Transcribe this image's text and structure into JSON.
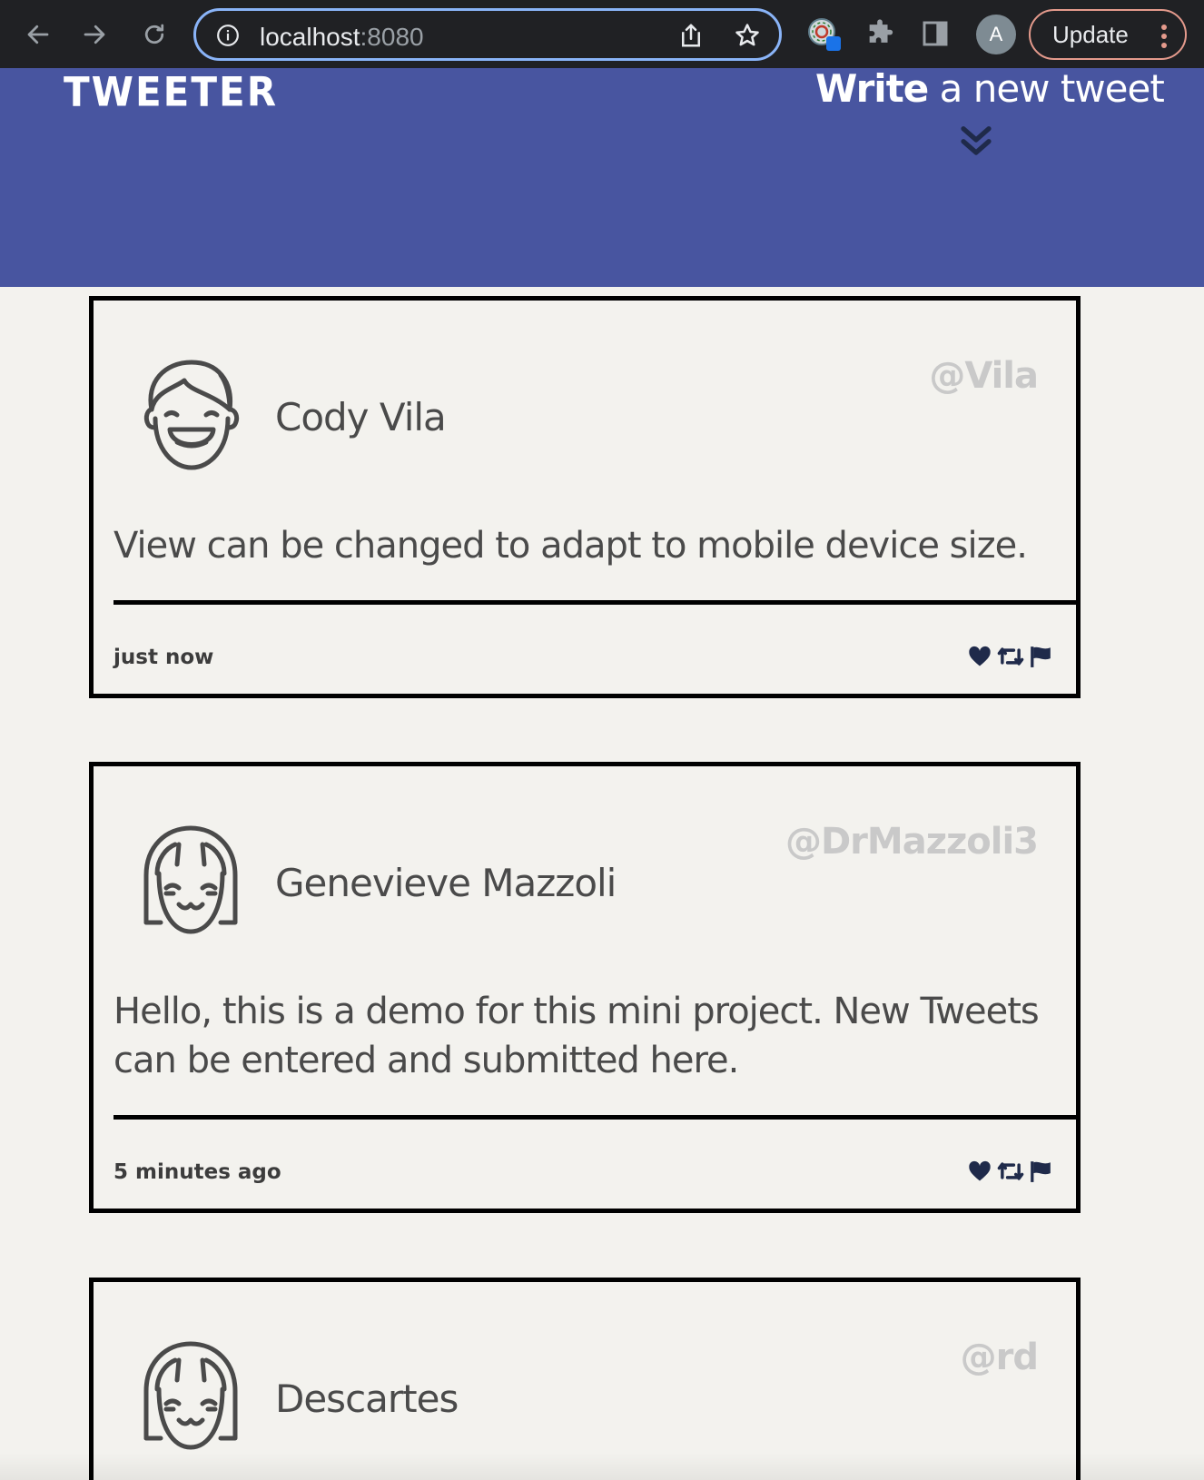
{
  "browser": {
    "url_host": "localhost",
    "url_port": ":8080",
    "profile_initial": "A",
    "update_label": "Update"
  },
  "app": {
    "logo": "TWEETER",
    "compose_bold": "Write",
    "compose_rest": " a new tweet"
  },
  "tweets": [
    {
      "name": "Cody Vila",
      "handle": "@Vila",
      "avatar": "smiling-boy-avatar-icon",
      "content": "View can be changed to adapt to mobile device size.",
      "time": "just now"
    },
    {
      "name": "Genevieve Mazzoli",
      "handle": "@DrMazzoli3",
      "avatar": "smiling-girl-avatar-icon",
      "content": "Hello, this is a demo for this mini project. New Tweets can be entered and submitted here.",
      "time": "5 minutes ago"
    },
    {
      "name": "Descartes",
      "handle": "@rd",
      "avatar": "smiling-girl-avatar-icon"
    }
  ],
  "colors": {
    "header_bg": "#4855a0",
    "page_bg": "#f3f2ee",
    "handle": "#c9c9c9",
    "icons": "#1f2a4a"
  }
}
